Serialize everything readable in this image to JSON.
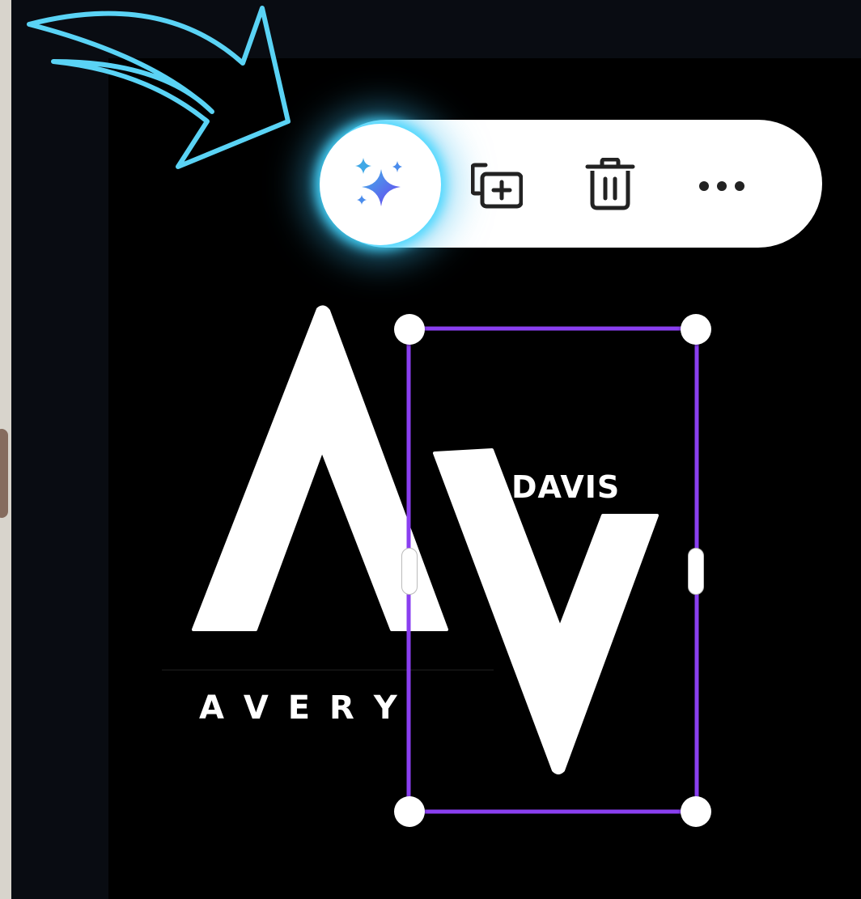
{
  "toolbar": {
    "ai_button_icon": "sparkles-icon",
    "duplicate_icon": "duplicate-add-icon",
    "delete_icon": "trash-icon",
    "more_icon": "more-horizontal-icon"
  },
  "annotation": {
    "arrow_color": "#5ad3f5",
    "glow_color": "#46d7ff"
  },
  "design": {
    "logo_top_text": "DAVIS",
    "logo_bottom_text": "A V E R Y",
    "selection_color": "#8a3ff0"
  }
}
